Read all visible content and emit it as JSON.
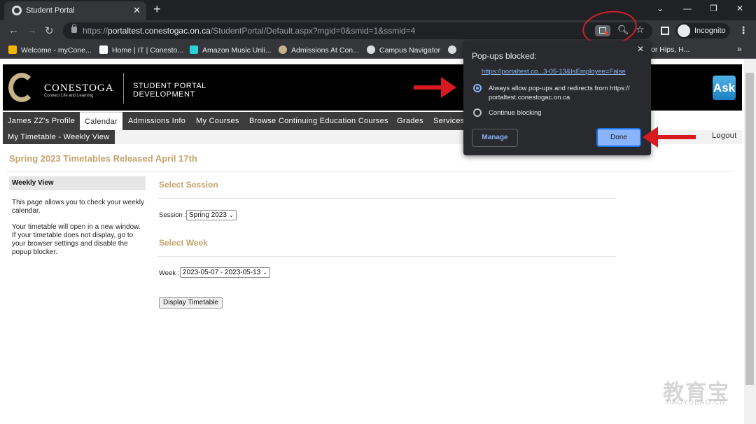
{
  "browser": {
    "tab_title": "Student Portal",
    "tab_close": "✕",
    "new_tab": "+",
    "url_prefix": "https://",
    "url_host": "portaltest.conestogac.on.ca",
    "url_path": "/StudentPortal/Default.aspx?mgid=0&smid=1&ssmid=4",
    "profile_label": "Incognito",
    "bookmarks": [
      {
        "label": "Welcome - myCone...",
        "color": "#f4b400"
      },
      {
        "label": "Home | IT | Conesto...",
        "color": "#ffffff"
      },
      {
        "label": "Amazon Music Unli...",
        "color": "#25d1da"
      },
      {
        "label": "Admissions At Con...",
        "color": "#c7b28a"
      },
      {
        "label": "Campus Navigator",
        "color": "#dadce0"
      },
      {
        "label": "or Hips, H...",
        "color": "#35363a"
      }
    ],
    "bookmarks_more": "»"
  },
  "popup": {
    "title": "Pop-ups blocked:",
    "close": "✕",
    "link": "https://portaltest.co...3-05-13&IsEmployee=False",
    "option_allow": "Always allow pop-ups and redirects from https:// portaltest.conestogac.on.ca",
    "option_block": "Continue blocking",
    "manage": "Manage",
    "done": "Done"
  },
  "site": {
    "brand": "CONESTOGA",
    "tagline": "Connect Life and Learning",
    "portal_line1": "STUDENT PORTAL",
    "portal_line2": "DEVELOPMENT",
    "ask": "Ask",
    "menu": [
      "James ZZ's Profile",
      "Calendar",
      "Admissions Info",
      "My Courses",
      "Browse Continuing Education Courses",
      "Grades",
      "Services"
    ],
    "submenu": "My Timetable - Weekly View",
    "logout": "Logout"
  },
  "main": {
    "heading": "Spring 2023 Timetables Released April 17th",
    "sidebar_title": "Weekly View",
    "sidebar_p1": "This page allows you to check your weekly calendar.",
    "sidebar_p2": "Your timetable will open in a new window. If your timetable does not display, go to your browser settings and disable the popup blocker.",
    "select_session_heading": "Select Session",
    "session_label": "Session :",
    "session_value": "Spring 2023",
    "select_week_heading": "Select Week",
    "week_label": "Week :",
    "week_value": "2023-05-07 - 2023-05-13",
    "display_button": "Display Timetable"
  },
  "watermark": {
    "main": "教育宝",
    "sub": "JIAOYUBAO.CN"
  },
  "colors": {
    "accent_gold": "#c5a46d",
    "arrow_red": "#d71920",
    "link_blue": "#8ab4f8"
  }
}
